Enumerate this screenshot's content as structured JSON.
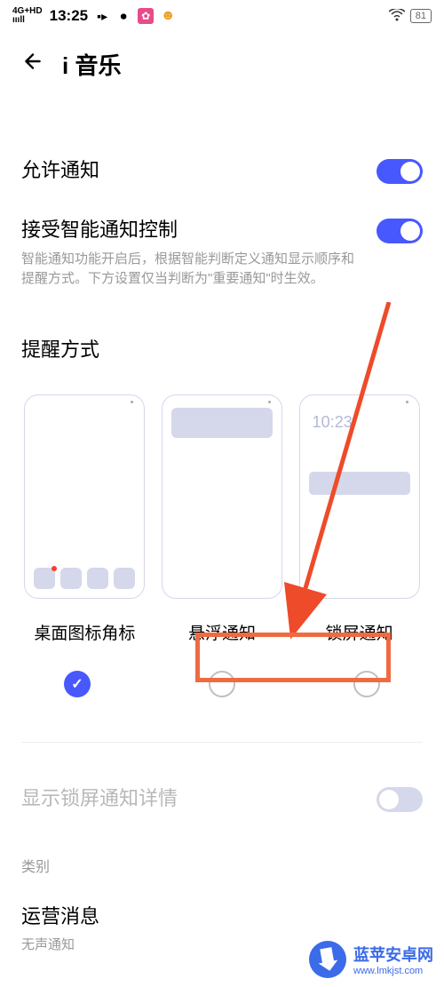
{
  "status_bar": {
    "signal": "4G+HD",
    "time": "13:25",
    "battery": "81"
  },
  "header": {
    "title": "i 音乐"
  },
  "settings": {
    "allow_notifications": {
      "title": "允许通知",
      "enabled": true
    },
    "smart_control": {
      "title": "接受智能通知控制",
      "desc": "智能通知功能开启后，根据智能判断定义通知显示顺序和提醒方式。下方设置仅当判断为\"重要通知\"时生效。",
      "enabled": true
    },
    "lock_screen_detail": {
      "title": "显示锁屏通知详情",
      "enabled": false
    }
  },
  "alert_section": {
    "title": "提醒方式",
    "options": [
      {
        "label": "桌面图标角标",
        "checked": true
      },
      {
        "label": "悬浮通知",
        "checked": false
      },
      {
        "label": "锁屏通知",
        "checked": false
      }
    ],
    "preview_lock_time": "10:23"
  },
  "category": {
    "label": "类别",
    "item_title": "运营消息",
    "item_sub": "无声通知"
  },
  "watermark": {
    "title": "蓝苹安卓网",
    "url": "www.lmkjst.com"
  },
  "highlight": {
    "color": "#ee6b42"
  }
}
